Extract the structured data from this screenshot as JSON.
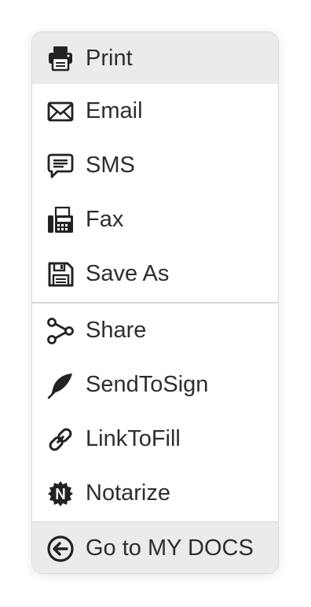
{
  "menu": {
    "items": [
      {
        "label": "Print",
        "icon": "printer-icon"
      },
      {
        "label": "Email",
        "icon": "envelope-icon"
      },
      {
        "label": "SMS",
        "icon": "message-icon"
      },
      {
        "label": "Fax",
        "icon": "fax-icon"
      },
      {
        "label": "Save As",
        "icon": "floppy-disk-icon"
      },
      {
        "label": "Share",
        "icon": "share-icon"
      },
      {
        "label": "SendToSign",
        "icon": "feather-icon"
      },
      {
        "label": "LinkToFill",
        "icon": "link-icon"
      },
      {
        "label": "Notarize",
        "icon": "notary-badge-icon"
      }
    ],
    "footer": {
      "label": "Go to MY DOCS",
      "icon": "circle-arrow-left-icon"
    }
  },
  "colors": {
    "text": "#2e2e2e",
    "icon": "#222222",
    "highlight": "#ebebeb",
    "divider": "#d6d6d6"
  }
}
